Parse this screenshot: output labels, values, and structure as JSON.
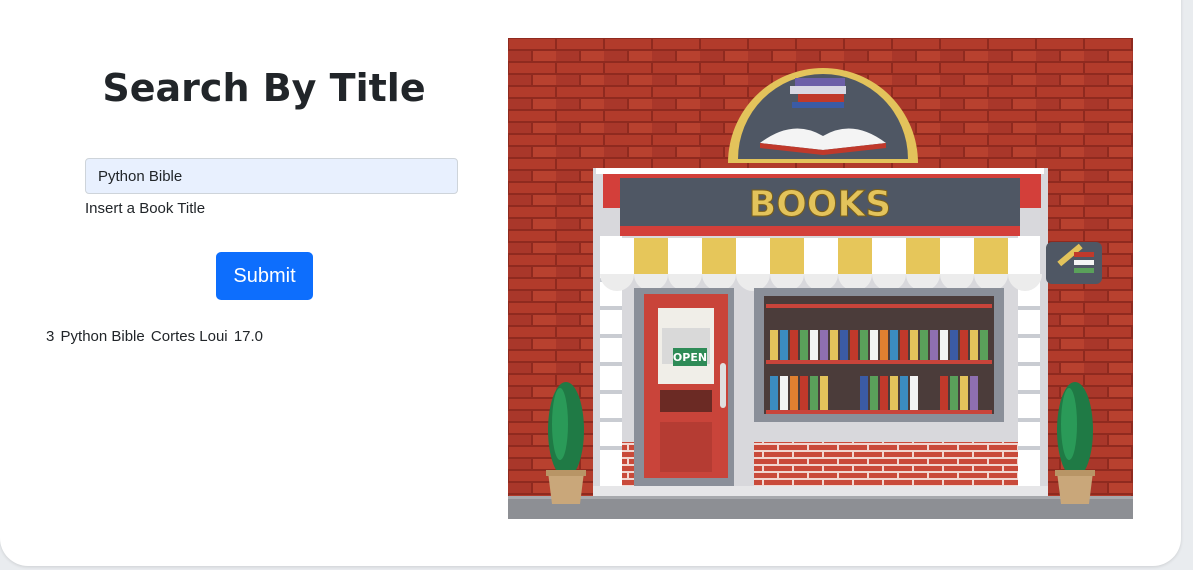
{
  "page": {
    "title": "Search By Title"
  },
  "search": {
    "value": "Python Bible",
    "hint": "Insert a Book Title",
    "submit_label": "Submit"
  },
  "results": [
    {
      "id": "3",
      "title": "Python Bible",
      "author": "Cortes Loui",
      "price": "17.0"
    }
  ],
  "illustration": {
    "sign_text": "BOOKS",
    "door_sign": "OPEN"
  },
  "colors": {
    "primary": "#0d6efd",
    "input_fill": "#e8f0fe",
    "brick": "#b23b2b",
    "awning_yellow": "#e6c65a"
  }
}
